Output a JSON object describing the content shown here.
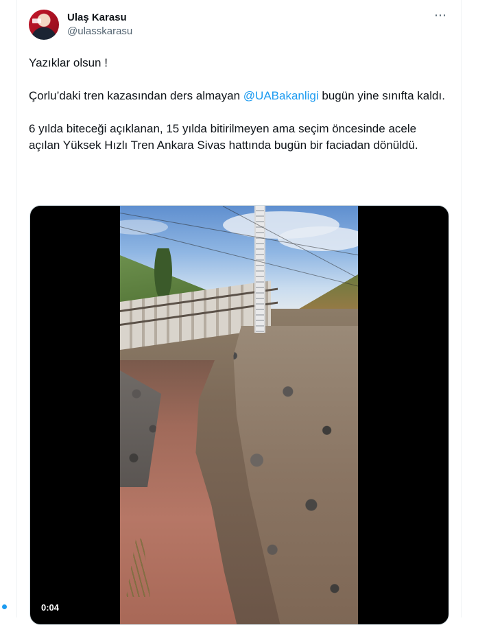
{
  "tweet": {
    "author": {
      "display_name": "Ulaş Karasu",
      "handle": "@ulasskarasu"
    },
    "more_icon": "more-horizontal-icon",
    "text": {
      "line1": "Yazıklar olsun !",
      "para2_before": "Çorlu’daki tren kazasından ders almayan ",
      "mention": "@UABakanligi",
      "para2_after": " bugün yine sınıfta kaldı.",
      "para3": "6 yılda biteceği açıklanan, 15 yılda bitirilmeyen ama seçim öncesinde acele açılan Yüksek Hızlı Tren Ankara Sivas hattında bugün bir faciadan dönüldü."
    },
    "media": {
      "duration": "0:04"
    }
  },
  "colors": {
    "accent": "#1d9bf0",
    "text_primary": "#0f1419",
    "text_secondary": "#536471"
  }
}
